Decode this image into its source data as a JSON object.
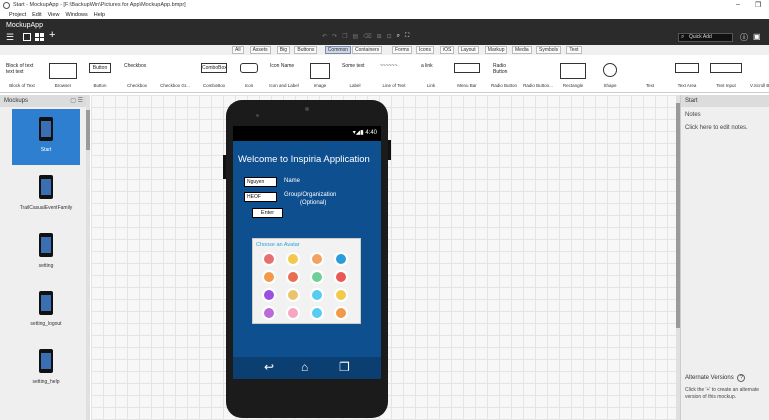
{
  "window": {
    "title": "Start - MockupApp - [F:\\BackupWin\\Pictures for App\\MockupApp.bmpr]",
    "minimize": "–",
    "restore": "❐"
  },
  "menu": [
    "Project",
    "Edit",
    "View",
    "Windows",
    "Help"
  ],
  "app": {
    "name": "MockupApp",
    "quick_add_placeholder": "Quick Add"
  },
  "categories": [
    {
      "label": "All",
      "active": false
    },
    {
      "label": "Assets",
      "active": false
    },
    {
      "label": "Big",
      "active": false
    },
    {
      "label": "Buttons",
      "active": false
    },
    {
      "label": "Common",
      "active": true
    },
    {
      "label": "Containers",
      "active": false
    },
    {
      "label": "Forms",
      "active": false
    },
    {
      "label": "Icons",
      "active": false
    },
    {
      "label": "iOS",
      "active": false
    },
    {
      "label": "Layout",
      "active": false
    },
    {
      "label": "Markup",
      "active": false
    },
    {
      "label": "Media",
      "active": false
    },
    {
      "label": "Symbols",
      "active": false
    },
    {
      "label": "Text",
      "active": false
    }
  ],
  "library": [
    {
      "label": "Block of Text",
      "preview": "Block of text text text"
    },
    {
      "label": "Browser",
      "preview": ""
    },
    {
      "label": "Button",
      "preview": "Button"
    },
    {
      "label": "Checkbox",
      "preview": "Checkbox"
    },
    {
      "label": "Checkbox Gr...",
      "preview": ""
    },
    {
      "label": "ComboBox",
      "preview": "ComboBox"
    },
    {
      "label": "Icon",
      "preview": ""
    },
    {
      "label": "Icon and Label",
      "preview": "Icon Name"
    },
    {
      "label": "Image",
      "preview": ""
    },
    {
      "label": "Label",
      "preview": "Some text"
    },
    {
      "label": "Line of Text",
      "preview": "~~~~~~"
    },
    {
      "label": "Link",
      "preview": "a link"
    },
    {
      "label": "Menu Bar",
      "preview": ""
    },
    {
      "label": "Radio Button",
      "preview": "Radio Button"
    },
    {
      "label": "Radio Button...",
      "preview": ""
    },
    {
      "label": "Rectangle",
      "preview": ""
    },
    {
      "label": "Shape",
      "preview": ""
    },
    {
      "label": "Text",
      "preview": ""
    },
    {
      "label": "Text Area",
      "preview": ""
    },
    {
      "label": "Text Input",
      "preview": ""
    },
    {
      "label": "V.Scroll Ba",
      "preview": ""
    }
  ],
  "left_panel": {
    "title": "Mockups",
    "items": [
      {
        "name": "Start",
        "selected": true
      },
      {
        "name": "TrailCasualEventFamily",
        "selected": false
      },
      {
        "name": "setting",
        "selected": false
      },
      {
        "name": "setting_logout",
        "selected": false
      },
      {
        "name": "setting_help",
        "selected": false
      }
    ]
  },
  "phone": {
    "status_time": "▾◢▮ 4:40",
    "welcome": "Welcome to Inspiria Application",
    "name_value": "Nguyen",
    "name_label": "Name",
    "group_value": "HEOF",
    "group_label": "Group/Organization",
    "group_sub": "(Optional)",
    "enter_label": "Enter",
    "avatar_title": "Choose an Avatar",
    "avatar_colors": [
      "#e7706e",
      "#f2c94c",
      "#f4a261",
      "#2d9cdb",
      "#f2994a",
      "#e76f51",
      "#6fcf97",
      "#eb5757",
      "#9b51e0",
      "#e9c46a",
      "#56ccf2",
      "#f2c94c",
      "#bb6bd9",
      "#f7a6c0",
      "#56ccf2",
      "#f2994a"
    ]
  },
  "right_panel": {
    "title": "Start",
    "notes_heading": "Notes",
    "notes_placeholder": "Click here to edit notes.",
    "alt_heading": "Alternate Versions",
    "alt_help": "?",
    "alt_desc": "Click the '+' to create an alternate version of this mockup."
  },
  "colors": {
    "accent": "#2f7fd0",
    "appbar": "#2b2b2b",
    "screen": "#0e4f8f"
  }
}
